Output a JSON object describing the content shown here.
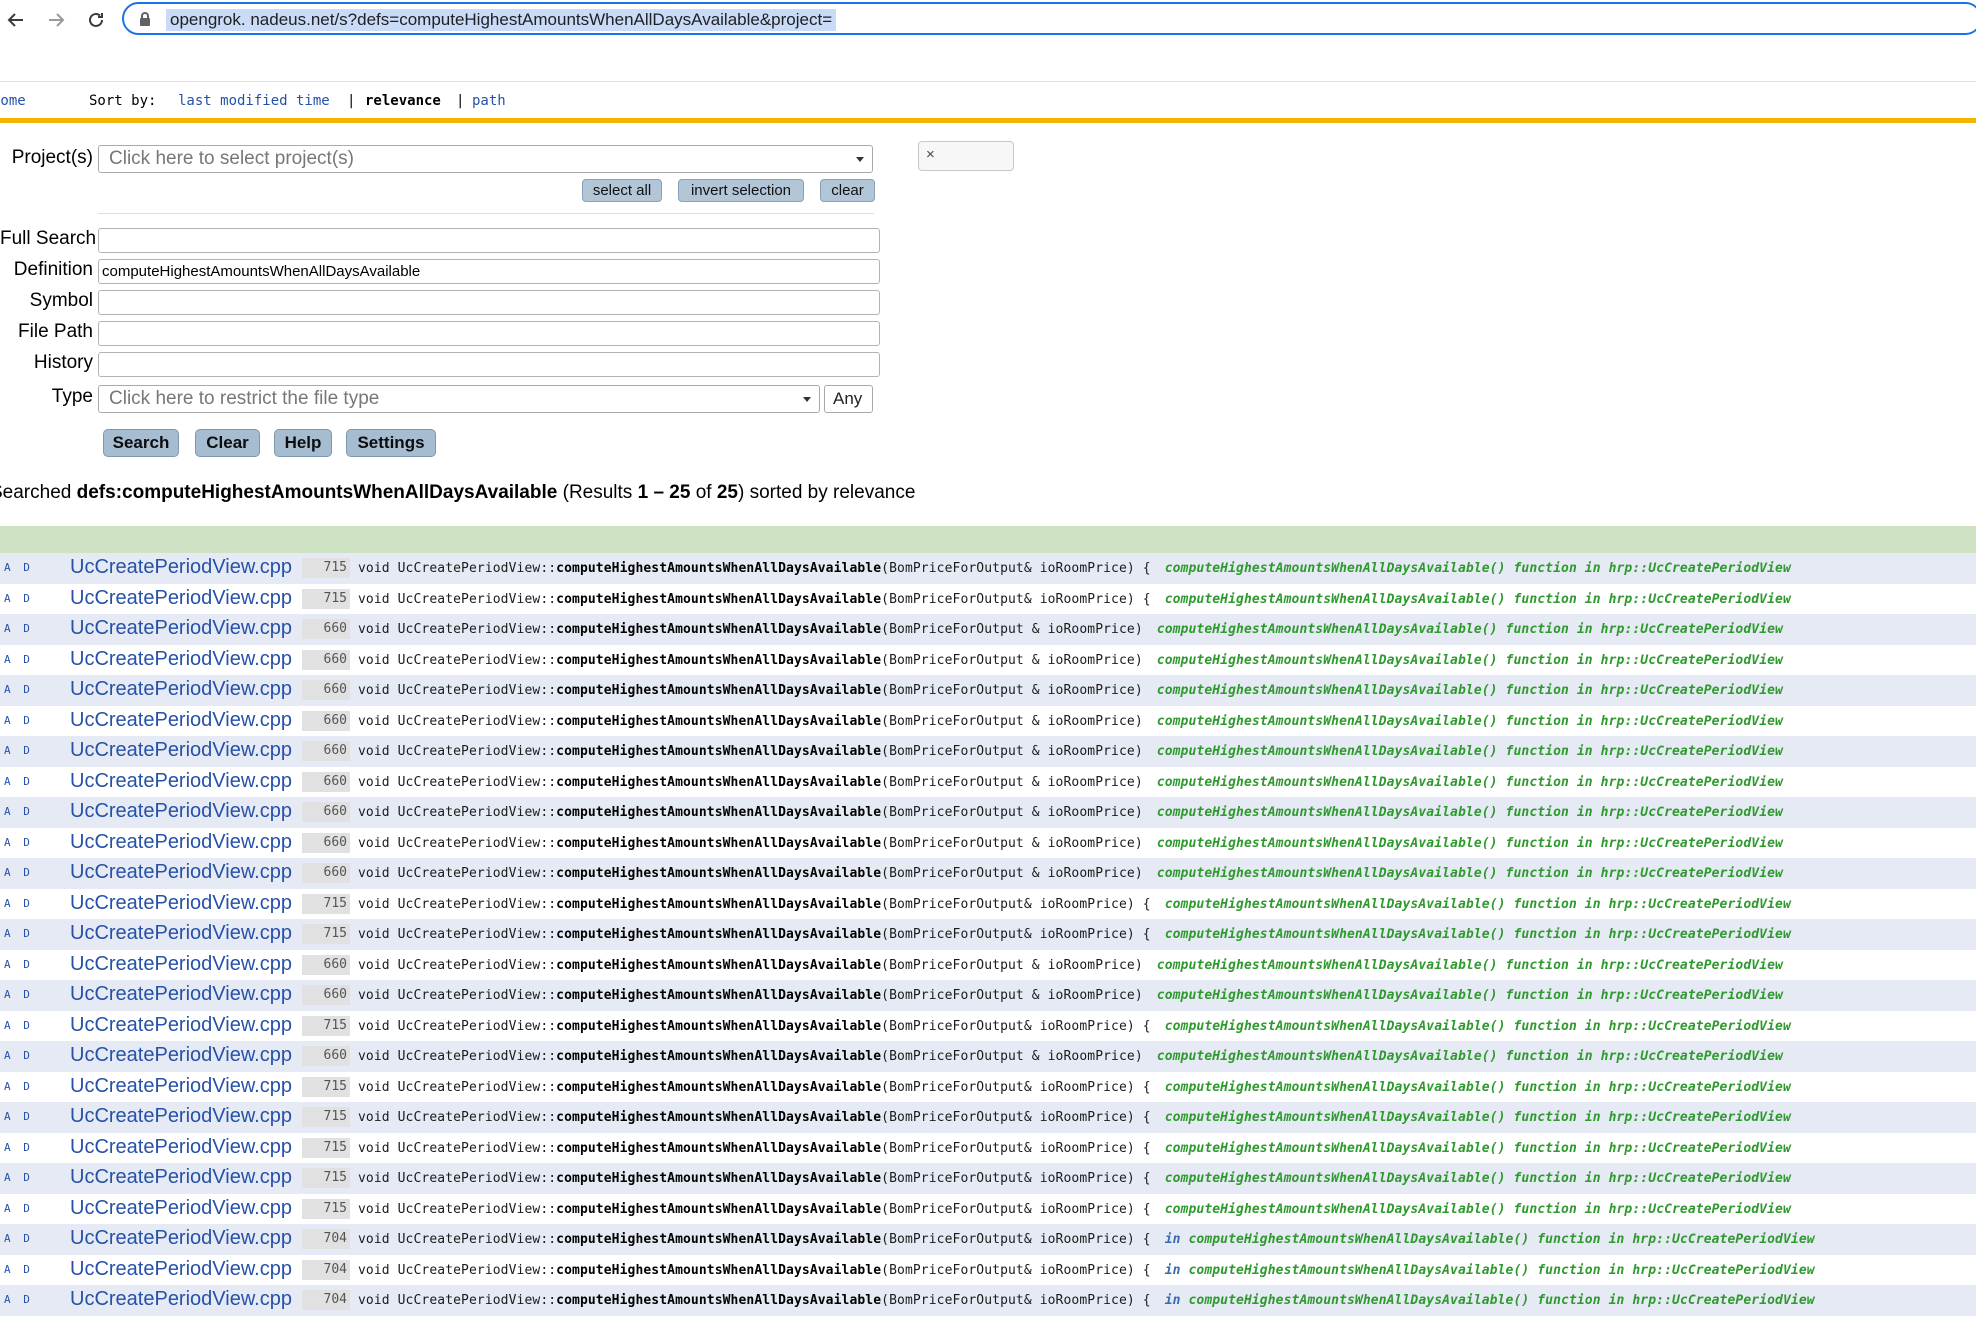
{
  "browser": {
    "url": "opengrok.             nadeus.net/s?defs=computeHighestAmountsWhenAllDaysAvailable&project=       "
  },
  "header": {
    "home": "Home",
    "sort_by": "Sort by:",
    "sort_last_modified": "last modified time",
    "sep1": "|",
    "sort_relevance": "relevance",
    "sep2": "|",
    "sort_path": "path"
  },
  "form": {
    "projects_label": "Project(s)",
    "projects_placeholder": "Click here to select project(s)",
    "select_all": "select all",
    "invert_selection": "invert selection",
    "clear_small": "clear",
    "chip_x": "×",
    "full_search_label": "Full Search",
    "full_search_value": "",
    "definition_label": "Definition",
    "definition_value": "computeHighestAmountsWhenAllDaysAvailable",
    "symbol_label": "Symbol",
    "symbol_value": "",
    "file_path_label": "File Path",
    "file_path_value": "",
    "history_label": "History",
    "history_value": "",
    "type_label": "Type",
    "type_placeholder": "Click here to restrict the file type",
    "type_any": "Any",
    "btn_search": "Search",
    "btn_clear": "Clear",
    "btn_help": "Help",
    "btn_settings": "Settings"
  },
  "summary": {
    "prefix": "Searched ",
    "query": "defs:computeHighestAmountsWhenAllDaysAvailable",
    "results_open": " (Results ",
    "range": "1 – 25",
    "of": " of ",
    "total": "25",
    "suffix": ") sorted by relevance"
  },
  "results": [
    {
      "ad": "A D",
      "file": "UcCreatePeriodView.cpp",
      "line": "715",
      "pre": "void UcCreatePeriodView::",
      "fn": "computeHighestAmountsWhenAllDaysAvailable",
      "post": "(BomPriceForOutput& ioRoomPrice) {",
      "tag_in": "",
      "tag": "computeHighestAmountsWhenAllDaysAvailable()  function in hrp::UcCreatePeriodView"
    },
    {
      "ad": "A D",
      "file": "UcCreatePeriodView.cpp",
      "line": "715",
      "pre": "void UcCreatePeriodView::",
      "fn": "computeHighestAmountsWhenAllDaysAvailable",
      "post": "(BomPriceForOutput& ioRoomPrice) {",
      "tag_in": "",
      "tag": "computeHighestAmountsWhenAllDaysAvailable()  function in hrp::UcCreatePeriodView"
    },
    {
      "ad": "A D",
      "file": "UcCreatePeriodView.cpp",
      "line": "660",
      "pre": "void UcCreatePeriodView::",
      "fn": "computeHighestAmountsWhenAllDaysAvailable",
      "post": "(BomPriceForOutput & ioRoomPrice)",
      "tag_in": "",
      "tag": "computeHighestAmountsWhenAllDaysAvailable()  function in hrp::UcCreatePeriodView"
    },
    {
      "ad": "A D",
      "file": "UcCreatePeriodView.cpp",
      "line": "660",
      "pre": "void UcCreatePeriodView::",
      "fn": "computeHighestAmountsWhenAllDaysAvailable",
      "post": "(BomPriceForOutput & ioRoomPrice)",
      "tag_in": "",
      "tag": "computeHighestAmountsWhenAllDaysAvailable()  function in hrp::UcCreatePeriodView"
    },
    {
      "ad": "A D",
      "file": "UcCreatePeriodView.cpp",
      "line": "660",
      "pre": "void UcCreatePeriodView::",
      "fn": "computeHighestAmountsWhenAllDaysAvailable",
      "post": "(BomPriceForOutput & ioRoomPrice)",
      "tag_in": "",
      "tag": "computeHighestAmountsWhenAllDaysAvailable()  function in hrp::UcCreatePeriodView"
    },
    {
      "ad": "A D",
      "file": "UcCreatePeriodView.cpp",
      "line": "660",
      "pre": "void UcCreatePeriodView::",
      "fn": "computeHighestAmountsWhenAllDaysAvailable",
      "post": "(BomPriceForOutput & ioRoomPrice)",
      "tag_in": "",
      "tag": "computeHighestAmountsWhenAllDaysAvailable()  function in hrp::UcCreatePeriodView"
    },
    {
      "ad": "A D",
      "file": "UcCreatePeriodView.cpp",
      "line": "660",
      "pre": "void UcCreatePeriodView::",
      "fn": "computeHighestAmountsWhenAllDaysAvailable",
      "post": "(BomPriceForOutput & ioRoomPrice)",
      "tag_in": "",
      "tag": "computeHighestAmountsWhenAllDaysAvailable()  function in hrp::UcCreatePeriodView"
    },
    {
      "ad": "A D",
      "file": "UcCreatePeriodView.cpp",
      "line": "660",
      "pre": "void UcCreatePeriodView::",
      "fn": "computeHighestAmountsWhenAllDaysAvailable",
      "post": "(BomPriceForOutput & ioRoomPrice)",
      "tag_in": "",
      "tag": "computeHighestAmountsWhenAllDaysAvailable()  function in hrp::UcCreatePeriodView"
    },
    {
      "ad": "A D",
      "file": "UcCreatePeriodView.cpp",
      "line": "660",
      "pre": "void UcCreatePeriodView::",
      "fn": "computeHighestAmountsWhenAllDaysAvailable",
      "post": "(BomPriceForOutput & ioRoomPrice)",
      "tag_in": "",
      "tag": "computeHighestAmountsWhenAllDaysAvailable()  function in hrp::UcCreatePeriodView"
    },
    {
      "ad": "A D",
      "file": "UcCreatePeriodView.cpp",
      "line": "660",
      "pre": "void UcCreatePeriodView::",
      "fn": "computeHighestAmountsWhenAllDaysAvailable",
      "post": "(BomPriceForOutput & ioRoomPrice)",
      "tag_in": "",
      "tag": "computeHighestAmountsWhenAllDaysAvailable()  function in hrp::UcCreatePeriodView"
    },
    {
      "ad": "A D",
      "file": "UcCreatePeriodView.cpp",
      "line": "660",
      "pre": "void UcCreatePeriodView::",
      "fn": "computeHighestAmountsWhenAllDaysAvailable",
      "post": "(BomPriceForOutput & ioRoomPrice)",
      "tag_in": "",
      "tag": "computeHighestAmountsWhenAllDaysAvailable()  function in hrp::UcCreatePeriodView"
    },
    {
      "ad": "A D",
      "file": "UcCreatePeriodView.cpp",
      "line": "715",
      "pre": "void UcCreatePeriodView::",
      "fn": "computeHighestAmountsWhenAllDaysAvailable",
      "post": "(BomPriceForOutput& ioRoomPrice) {",
      "tag_in": "",
      "tag": "computeHighestAmountsWhenAllDaysAvailable()  function in hrp::UcCreatePeriodView"
    },
    {
      "ad": "A D",
      "file": "UcCreatePeriodView.cpp",
      "line": "715",
      "pre": "void UcCreatePeriodView::",
      "fn": "computeHighestAmountsWhenAllDaysAvailable",
      "post": "(BomPriceForOutput& ioRoomPrice) {",
      "tag_in": "",
      "tag": "computeHighestAmountsWhenAllDaysAvailable()  function in hrp::UcCreatePeriodView"
    },
    {
      "ad": "A D",
      "file": "UcCreatePeriodView.cpp",
      "line": "660",
      "pre": "void UcCreatePeriodView::",
      "fn": "computeHighestAmountsWhenAllDaysAvailable",
      "post": "(BomPriceForOutput & ioRoomPrice)",
      "tag_in": "",
      "tag": "computeHighestAmountsWhenAllDaysAvailable()  function in hrp::UcCreatePeriodView"
    },
    {
      "ad": "A D",
      "file": "UcCreatePeriodView.cpp",
      "line": "660",
      "pre": "void UcCreatePeriodView::",
      "fn": "computeHighestAmountsWhenAllDaysAvailable",
      "post": "(BomPriceForOutput & ioRoomPrice)",
      "tag_in": "",
      "tag": "computeHighestAmountsWhenAllDaysAvailable()  function in hrp::UcCreatePeriodView"
    },
    {
      "ad": "A D",
      "file": "UcCreatePeriodView.cpp",
      "line": "715",
      "pre": "void UcCreatePeriodView::",
      "fn": "computeHighestAmountsWhenAllDaysAvailable",
      "post": "(BomPriceForOutput& ioRoomPrice) {",
      "tag_in": "",
      "tag": "computeHighestAmountsWhenAllDaysAvailable()  function in hrp::UcCreatePeriodView"
    },
    {
      "ad": "A D",
      "file": "UcCreatePeriodView.cpp",
      "line": "660",
      "pre": "void UcCreatePeriodView::",
      "fn": "computeHighestAmountsWhenAllDaysAvailable",
      "post": "(BomPriceForOutput & ioRoomPrice)",
      "tag_in": "",
      "tag": "computeHighestAmountsWhenAllDaysAvailable()  function in hrp::UcCreatePeriodView"
    },
    {
      "ad": "A D",
      "file": "UcCreatePeriodView.cpp",
      "line": "715",
      "pre": "void UcCreatePeriodView::",
      "fn": "computeHighestAmountsWhenAllDaysAvailable",
      "post": "(BomPriceForOutput& ioRoomPrice) {",
      "tag_in": "",
      "tag": "computeHighestAmountsWhenAllDaysAvailable()  function in hrp::UcCreatePeriodView"
    },
    {
      "ad": "A D",
      "file": "UcCreatePeriodView.cpp",
      "line": "715",
      "pre": "void UcCreatePeriodView::",
      "fn": "computeHighestAmountsWhenAllDaysAvailable",
      "post": "(BomPriceForOutput& ioRoomPrice) {",
      "tag_in": "",
      "tag": "computeHighestAmountsWhenAllDaysAvailable()  function in hrp::UcCreatePeriodView"
    },
    {
      "ad": "A D",
      "file": "UcCreatePeriodView.cpp",
      "line": "715",
      "pre": "void UcCreatePeriodView::",
      "fn": "computeHighestAmountsWhenAllDaysAvailable",
      "post": "(BomPriceForOutput& ioRoomPrice) {",
      "tag_in": "",
      "tag": "computeHighestAmountsWhenAllDaysAvailable()  function in hrp::UcCreatePeriodView"
    },
    {
      "ad": "A D",
      "file": "UcCreatePeriodView.cpp",
      "line": "715",
      "pre": "void UcCreatePeriodView::",
      "fn": "computeHighestAmountsWhenAllDaysAvailable",
      "post": "(BomPriceForOutput& ioRoomPrice) {",
      "tag_in": "",
      "tag": "computeHighestAmountsWhenAllDaysAvailable()  function in hrp::UcCreatePeriodView"
    },
    {
      "ad": "A D",
      "file": "UcCreatePeriodView.cpp",
      "line": "715",
      "pre": "void UcCreatePeriodView::",
      "fn": "computeHighestAmountsWhenAllDaysAvailable",
      "post": "(BomPriceForOutput& ioRoomPrice) {",
      "tag_in": "",
      "tag": "computeHighestAmountsWhenAllDaysAvailable()  function in hrp::UcCreatePeriodView"
    },
    {
      "ad": "A D",
      "file": "UcCreatePeriodView.cpp",
      "line": "704",
      "pre": "void UcCreatePeriodView::",
      "fn": "computeHighestAmountsWhenAllDaysAvailable",
      "post": "(BomPriceForOutput& ioRoomPrice) {",
      "tag_in": "in ",
      "tag": "computeHighestAmountsWhenAllDaysAvailable()  function in hrp::UcCreatePeriodView"
    },
    {
      "ad": "A D",
      "file": "UcCreatePeriodView.cpp",
      "line": "704",
      "pre": "void UcCreatePeriodView::",
      "fn": "computeHighestAmountsWhenAllDaysAvailable",
      "post": "(BomPriceForOutput& ioRoomPrice) {",
      "tag_in": "in ",
      "tag": "computeHighestAmountsWhenAllDaysAvailable()  function in hrp::UcCreatePeriodView"
    },
    {
      "ad": "A D",
      "file": "UcCreatePeriodView.cpp",
      "line": "704",
      "pre": "void UcCreatePeriodView::",
      "fn": "computeHighestAmountsWhenAllDaysAvailable",
      "post": "(BomPriceForOutput& ioRoomPrice) {",
      "tag_in": "in ",
      "tag": "computeHighestAmountsWhenAllDaysAvailable()  function in hrp::UcCreatePeriodView"
    }
  ]
}
